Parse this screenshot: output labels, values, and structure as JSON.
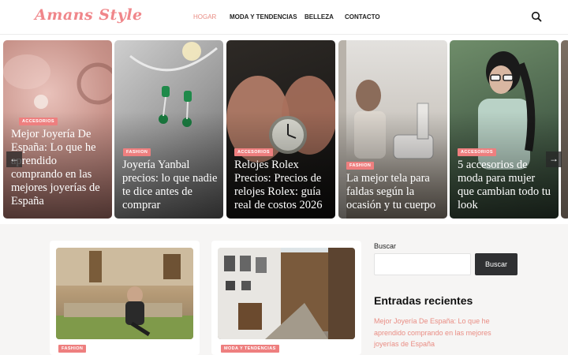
{
  "header": {
    "logo": "Amans Style",
    "nav": [
      "HOGAR",
      "MODA Y TENDENCIAS",
      "BELLEZA",
      "CONTACTO"
    ]
  },
  "slider": {
    "slides": [
      {
        "badge": "ACCESORIOS",
        "title": "Mejor Joyería De España: Lo que he aprendido comprando en las mejores joyerías de España"
      },
      {
        "badge": "FASHION",
        "title": "Joyería Yanbal precios: lo que nadie te dice antes de comprar"
      },
      {
        "badge": "ACCESORIOS",
        "title": "Relojes Rolex Precios: Precios de relojes Rolex: guía real de costos 2026"
      },
      {
        "badge": "FASHION",
        "title": "La mejor tela para faldas según la ocasión y tu cuerpo"
      },
      {
        "badge": "ACCESORIOS",
        "title": "5 accesorios de moda para mujer que cambian todo tu look"
      }
    ],
    "prev_icon": "arrow-left-icon",
    "next_icon": "arrow-right-icon"
  },
  "cards": [
    {
      "badge": "FASHION"
    },
    {
      "badge": "MODA Y TENDENCIAS"
    }
  ],
  "sidebar": {
    "search_label": "Buscar",
    "search_button": "Buscar",
    "recent_title": "Entradas recientes",
    "recent_link": "Mejor Joyería De España: Lo que he aprendido comprando en las mejores joyerías de España"
  },
  "colors": {
    "accent": "#ee7f7f",
    "link": "#e98d84",
    "logo": "#f0868a",
    "button": "#2f3032"
  }
}
